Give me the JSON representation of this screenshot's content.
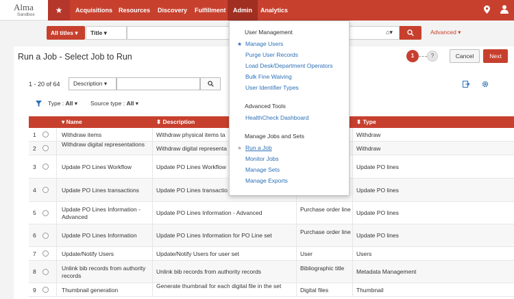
{
  "logo": {
    "name": "Alma",
    "env": "Sandbox"
  },
  "nav": {
    "star": "★",
    "items": [
      "Acquisitions",
      "Resources",
      "Discovery",
      "Fulfillment",
      "Admin",
      "Analytics"
    ],
    "pin_icon": "map-pin-icon",
    "user_icon": "user-icon"
  },
  "search": {
    "scope": "All titles ▾",
    "field": "Title  ▾",
    "value": "",
    "advanced": "Advanced ▾"
  },
  "page": {
    "title": "Run a Job - Select Job to Run",
    "step1": "1",
    "step2": "?",
    "cancel": "Cancel",
    "next": "Next",
    "count": "1 - 20 of 64",
    "search_field": "Description  ▾",
    "search_value": ""
  },
  "filters": {
    "type_label": "Type :",
    "type_value": "All",
    "source_label": "Source type :",
    "source_value": "All"
  },
  "table": {
    "headers": {
      "name": "▾ Name",
      "description": "⬍ Description",
      "type": "⬍ Type"
    },
    "rows": [
      {
        "n": "1",
        "name": "Withdraw items",
        "desc": "Withdraw physical items ta",
        "src": "",
        "type": "Withdraw"
      },
      {
        "n": "2",
        "name": "Withdraw digital representations",
        "desc": "Withdraw digital representa",
        "src": "",
        "type": "Withdraw"
      },
      {
        "n": "3",
        "name": "Update PO Lines Workflow",
        "desc": "Update PO Lines Workflow",
        "src": "",
        "type": "Update PO lines"
      },
      {
        "n": "4",
        "name": "Update PO Lines transactions",
        "desc": "Update PO Lines transactio",
        "src": "line",
        "type": "Update PO lines"
      },
      {
        "n": "5",
        "name": "Update PO Lines Information - Advanced",
        "desc": "Update PO Lines Information - Advanced",
        "src": "Purchase order line",
        "type": "Update PO lines"
      },
      {
        "n": "6",
        "name": "Update PO Lines Information",
        "desc": "Update PO Lines Information for PO Line set",
        "src": "Purchase order line",
        "type": "Update PO lines"
      },
      {
        "n": "7",
        "name": "Update/Notify Users",
        "desc": "Update/Notify Users for user set",
        "src": "User",
        "type": "Users"
      },
      {
        "n": "8",
        "name": "Unlink bib records from authority records",
        "desc": "Unlink bib records from authority records",
        "src": "Bibliographic title",
        "type": "Metadata Management"
      },
      {
        "n": "9",
        "name": "Thumbnail generation",
        "desc": "Generate thumbnail for each digital file in the set",
        "src": "Digital files",
        "type": "Thumbnail"
      }
    ]
  },
  "admin_menu": {
    "user_mgmt": "User Management",
    "manage_users": "Manage Users",
    "purge_users": "Purge User Records",
    "load_dept": "Load Desk/Department Operators",
    "bulk_fine": "Bulk Fine Waiving",
    "uid_types": "User Identifier Types",
    "adv_tools": "Advanced Tools",
    "healthcheck": "HealthCheck Dashboard",
    "jobs_sets": "Manage Jobs and Sets",
    "run_job": "Run a Job",
    "monitor_jobs": "Monitor Jobs",
    "manage_sets": "Manage Sets",
    "manage_exports": "Manage Exports"
  },
  "colors": {
    "brand": "#c7402e",
    "link": "#2a6fb7"
  }
}
